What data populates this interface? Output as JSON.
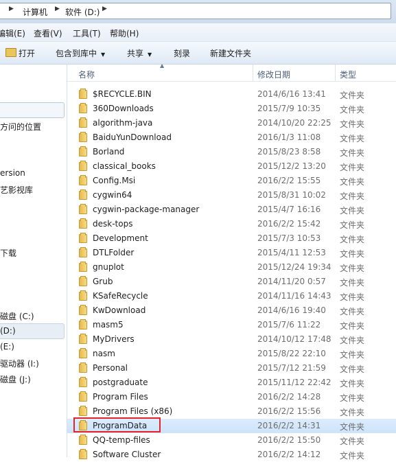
{
  "address": {
    "crumbs": [
      "计算机",
      "软件 (D:)"
    ]
  },
  "menu": [
    "编辑(E)",
    "查看(V)",
    "工具(T)",
    "帮助(H)"
  ],
  "toolbar": {
    "open": "打开",
    "include_in_library": "包含到库中",
    "share": "共享",
    "burn": "刻录",
    "new_folder": "新建文件夹"
  },
  "nav": {
    "recent_places": "方问的位置",
    "version": "ersion",
    "video_library": "艺影视库",
    "downloads": "下载",
    "drive_c": "磁盘 (C:)",
    "drive_d": "(D:)",
    "drive_e": "(E:)",
    "drive_i": "驱动器 (I:)",
    "drive_j": "磁盘 (J:)"
  },
  "columns": {
    "name": "名称",
    "modified": "修改日期",
    "type": "类型"
  },
  "files": [
    {
      "name": "$RECYCLE.BIN",
      "date": "2014/6/16 13:41",
      "type": "文件夹"
    },
    {
      "name": "360Downloads",
      "date": "2015/7/9 10:35",
      "type": "文件夹"
    },
    {
      "name": "algorithm-java",
      "date": "2014/10/20 22:25",
      "type": "文件夹"
    },
    {
      "name": "BaiduYunDownload",
      "date": "2016/1/3 11:08",
      "type": "文件夹"
    },
    {
      "name": "Borland",
      "date": "2015/8/23 8:58",
      "type": "文件夹"
    },
    {
      "name": "classical_books",
      "date": "2015/12/2 13:20",
      "type": "文件夹"
    },
    {
      "name": "Config.Msi",
      "date": "2016/2/2 15:55",
      "type": "文件夹"
    },
    {
      "name": "cygwin64",
      "date": "2015/8/31 10:02",
      "type": "文件夹"
    },
    {
      "name": "cygwin-package-manager",
      "date": "2015/4/7 16:16",
      "type": "文件夹"
    },
    {
      "name": "desk-tops",
      "date": "2016/2/2 15:42",
      "type": "文件夹"
    },
    {
      "name": "Development",
      "date": "2015/7/3 10:53",
      "type": "文件夹"
    },
    {
      "name": "DTLFolder",
      "date": "2015/4/11 12:53",
      "type": "文件夹"
    },
    {
      "name": "gnuplot",
      "date": "2015/12/24 19:34",
      "type": "文件夹"
    },
    {
      "name": "Grub",
      "date": "2014/11/20 0:57",
      "type": "文件夹"
    },
    {
      "name": "KSafeRecycle",
      "date": "2014/11/16 14:43",
      "type": "文件夹"
    },
    {
      "name": "KwDownload",
      "date": "2014/6/16 19:40",
      "type": "文件夹"
    },
    {
      "name": "masm5",
      "date": "2015/7/6 11:22",
      "type": "文件夹"
    },
    {
      "name": "MyDrivers",
      "date": "2014/10/12 17:48",
      "type": "文件夹"
    },
    {
      "name": "nasm",
      "date": "2015/8/22 22:10",
      "type": "文件夹"
    },
    {
      "name": "Personal",
      "date": "2015/7/12 21:59",
      "type": "文件夹"
    },
    {
      "name": "postgraduate",
      "date": "2015/11/12 22:42",
      "type": "文件夹"
    },
    {
      "name": "Program Files",
      "date": "2016/2/2 14:28",
      "type": "文件夹"
    },
    {
      "name": "Program Files (x86)",
      "date": "2016/2/2 15:56",
      "type": "文件夹"
    },
    {
      "name": "ProgramData",
      "date": "2016/2/2 14:31",
      "type": "文件夹",
      "selected": true
    },
    {
      "name": "QQ-temp-files",
      "date": "2016/2/2 15:50",
      "type": "文件夹"
    },
    {
      "name": "Software Cluster",
      "date": "2016/2/2 14:12",
      "type": "文件夹"
    }
  ]
}
